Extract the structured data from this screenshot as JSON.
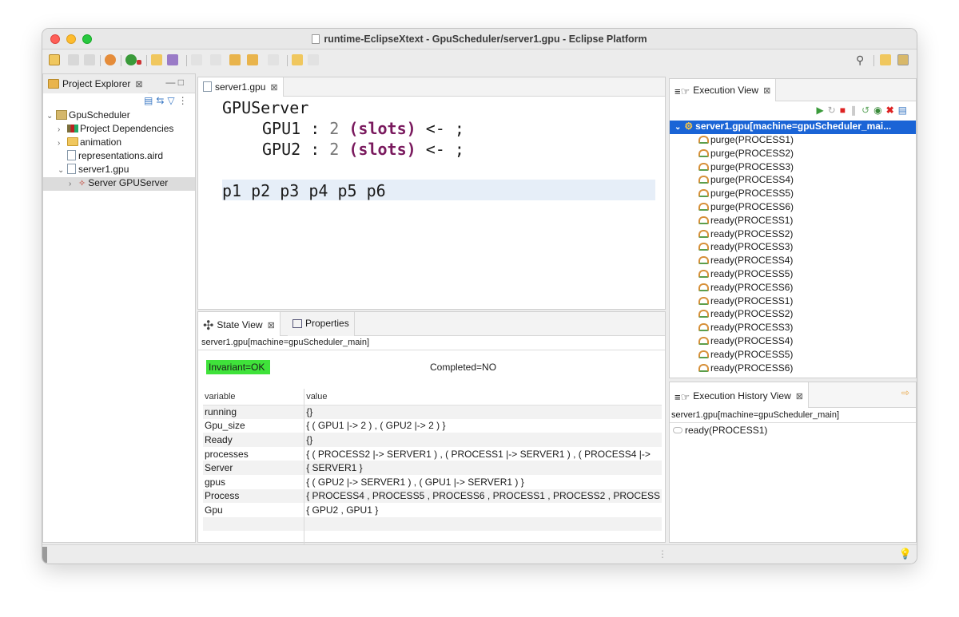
{
  "window": {
    "title": "runtime-EclipseXtext - GpuScheduler/server1.gpu - Eclipse Platform"
  },
  "project_explorer": {
    "tab_label": "Project Explorer",
    "close": "⊠",
    "tree": [
      {
        "label": "GpuScheduler",
        "twisty": "⌄"
      },
      {
        "label": "Project Dependencies",
        "twisty": "›"
      },
      {
        "label": "animation",
        "twisty": "›"
      },
      {
        "label": "representations.aird",
        "twisty": ""
      },
      {
        "label": "server1.gpu",
        "twisty": "⌄"
      },
      {
        "label": "Server GPUServer",
        "twisty": "›"
      }
    ]
  },
  "editor": {
    "tab_label": "server1.gpu",
    "close": "⊠",
    "line1": "GPUServer",
    "gpu1_name": "GPU1 :",
    "gpu1_num": "2",
    "gpu1_kw": "(slots)",
    "gpu1_tail": "<- ;",
    "gpu2_name": "GPU2 :",
    "gpu2_num": "2",
    "gpu2_kw": "(slots)",
    "gpu2_tail": "<- ;",
    "processes_line": "p1 p2 p3 p4 p5 p6"
  },
  "state_view": {
    "tab_label": "State View",
    "properties_tab": "Properties",
    "close": "⊠",
    "machine": "server1.gpu[machine=gpuScheduler_main]",
    "invariant": "Invariant=OK",
    "completed": "Completed=NO",
    "headers": {
      "variable": "variable",
      "value": "value"
    },
    "rows": [
      {
        "variable": "running",
        "value": "{}"
      },
      {
        "variable": "Gpu_size",
        "value": "{ ( GPU1 |-> 2 ) , ( GPU2 |-> 2 ) }"
      },
      {
        "variable": "Ready",
        "value": "{}"
      },
      {
        "variable": "processes",
        "value": "{ ( PROCESS2 |-> SERVER1 ) , ( PROCESS1 |-> SERVER1 ) , ( PROCESS4 |->"
      },
      {
        "variable": "Server",
        "value": "{ SERVER1 }"
      },
      {
        "variable": "gpus",
        "value": "{ ( GPU2 |-> SERVER1 ) , ( GPU1 |-> SERVER1 ) }"
      },
      {
        "variable": "Process",
        "value": "{ PROCESS4 , PROCESS5 , PROCESS6 , PROCESS1 , PROCESS2 , PROCESS"
      },
      {
        "variable": "Gpu",
        "value": "{ GPU2 , GPU1 }"
      },
      {
        "variable": "",
        "value": ""
      },
      {
        "variable": "",
        "value": ""
      }
    ]
  },
  "execution_view": {
    "tab_label": "Execution View",
    "close": "⊠",
    "root": "server1.gpu[machine=gpuScheduler_mai...",
    "items": [
      "purge(PROCESS1)",
      "purge(PROCESS2)",
      "purge(PROCESS3)",
      "purge(PROCESS4)",
      "purge(PROCESS5)",
      "purge(PROCESS6)",
      "ready(PROCESS1)",
      "ready(PROCESS2)",
      "ready(PROCESS3)",
      "ready(PROCESS4)",
      "ready(PROCESS5)",
      "ready(PROCESS6)",
      "ready(PROCESS1)",
      "ready(PROCESS2)",
      "ready(PROCESS3)",
      "ready(PROCESS4)",
      "ready(PROCESS5)",
      "ready(PROCESS6)"
    ]
  },
  "history_view": {
    "tab_label": "Execution History View",
    "close": "⊠",
    "machine": "server1.gpu[machine=gpuScheduler_main]",
    "items": [
      "ready(PROCESS1)"
    ]
  },
  "colors": {
    "invariant_ok": "#3fe23a",
    "selection": "#1a64d6",
    "keyword": "#7a1a5e"
  }
}
